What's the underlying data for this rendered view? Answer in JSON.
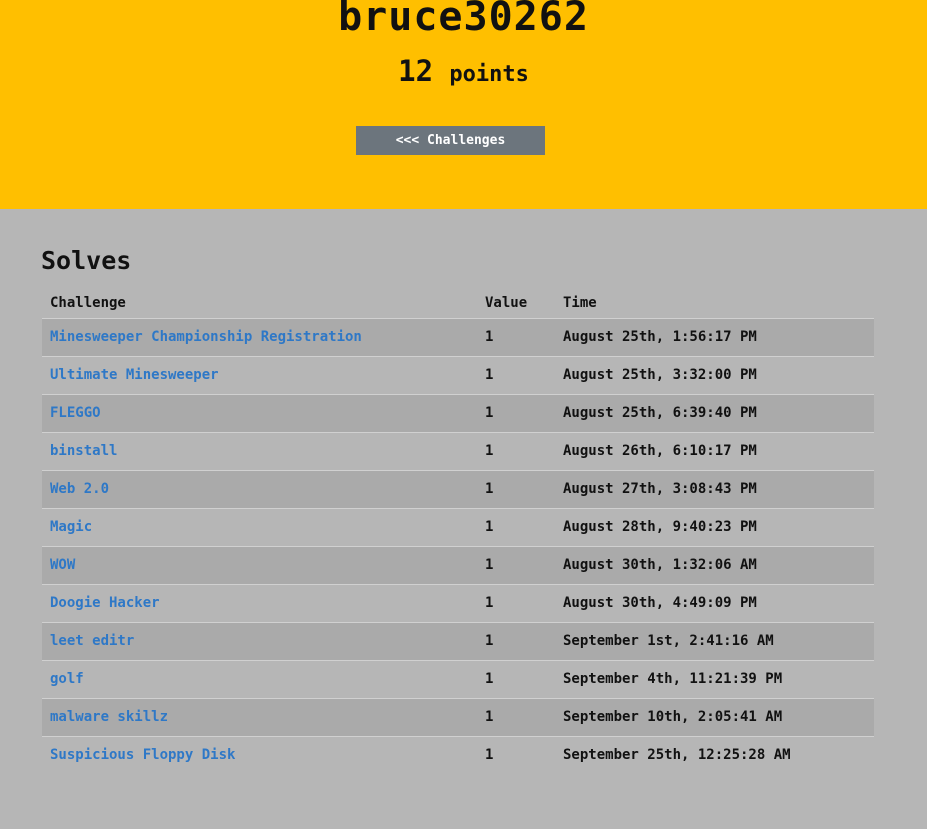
{
  "header": {
    "username": "bruce30262",
    "points_value": "12",
    "points_label": "points",
    "back_button_label": "<<< Challenges"
  },
  "solves": {
    "title": "Solves",
    "columns": [
      "Challenge",
      "Value",
      "Time"
    ],
    "rows": [
      {
        "challenge": "Minesweeper Championship Registration",
        "value": "1",
        "time": "August 25th, 1:56:17 PM"
      },
      {
        "challenge": "Ultimate Minesweeper",
        "value": "1",
        "time": "August 25th, 3:32:00 PM"
      },
      {
        "challenge": "FLEGGO",
        "value": "1",
        "time": "August 25th, 6:39:40 PM"
      },
      {
        "challenge": "binstall",
        "value": "1",
        "time": "August 26th, 6:10:17 PM"
      },
      {
        "challenge": "Web 2.0",
        "value": "1",
        "time": "August 27th, 3:08:43 PM"
      },
      {
        "challenge": "Magic",
        "value": "1",
        "time": "August 28th, 9:40:23 PM"
      },
      {
        "challenge": "WOW",
        "value": "1",
        "time": "August 30th, 1:32:06 AM"
      },
      {
        "challenge": "Doogie Hacker",
        "value": "1",
        "time": "August 30th, 4:49:09 PM"
      },
      {
        "challenge": "leet editr",
        "value": "1",
        "time": "September 1st, 2:41:16 AM"
      },
      {
        "challenge": "golf",
        "value": "1",
        "time": "September 4th, 11:21:39 PM"
      },
      {
        "challenge": "malware skillz",
        "value": "1",
        "time": "September 10th, 2:05:41 AM"
      },
      {
        "challenge": "Suspicious Floppy Disk",
        "value": "1",
        "time": "September 25th, 12:25:28 AM"
      }
    ]
  },
  "colors": {
    "header_bg": "#ffbf00",
    "body_bg": "#b6b6b6",
    "stripe_bg": "#aaaaaa",
    "link": "#2e78c7",
    "button_bg": "#6c757d"
  }
}
